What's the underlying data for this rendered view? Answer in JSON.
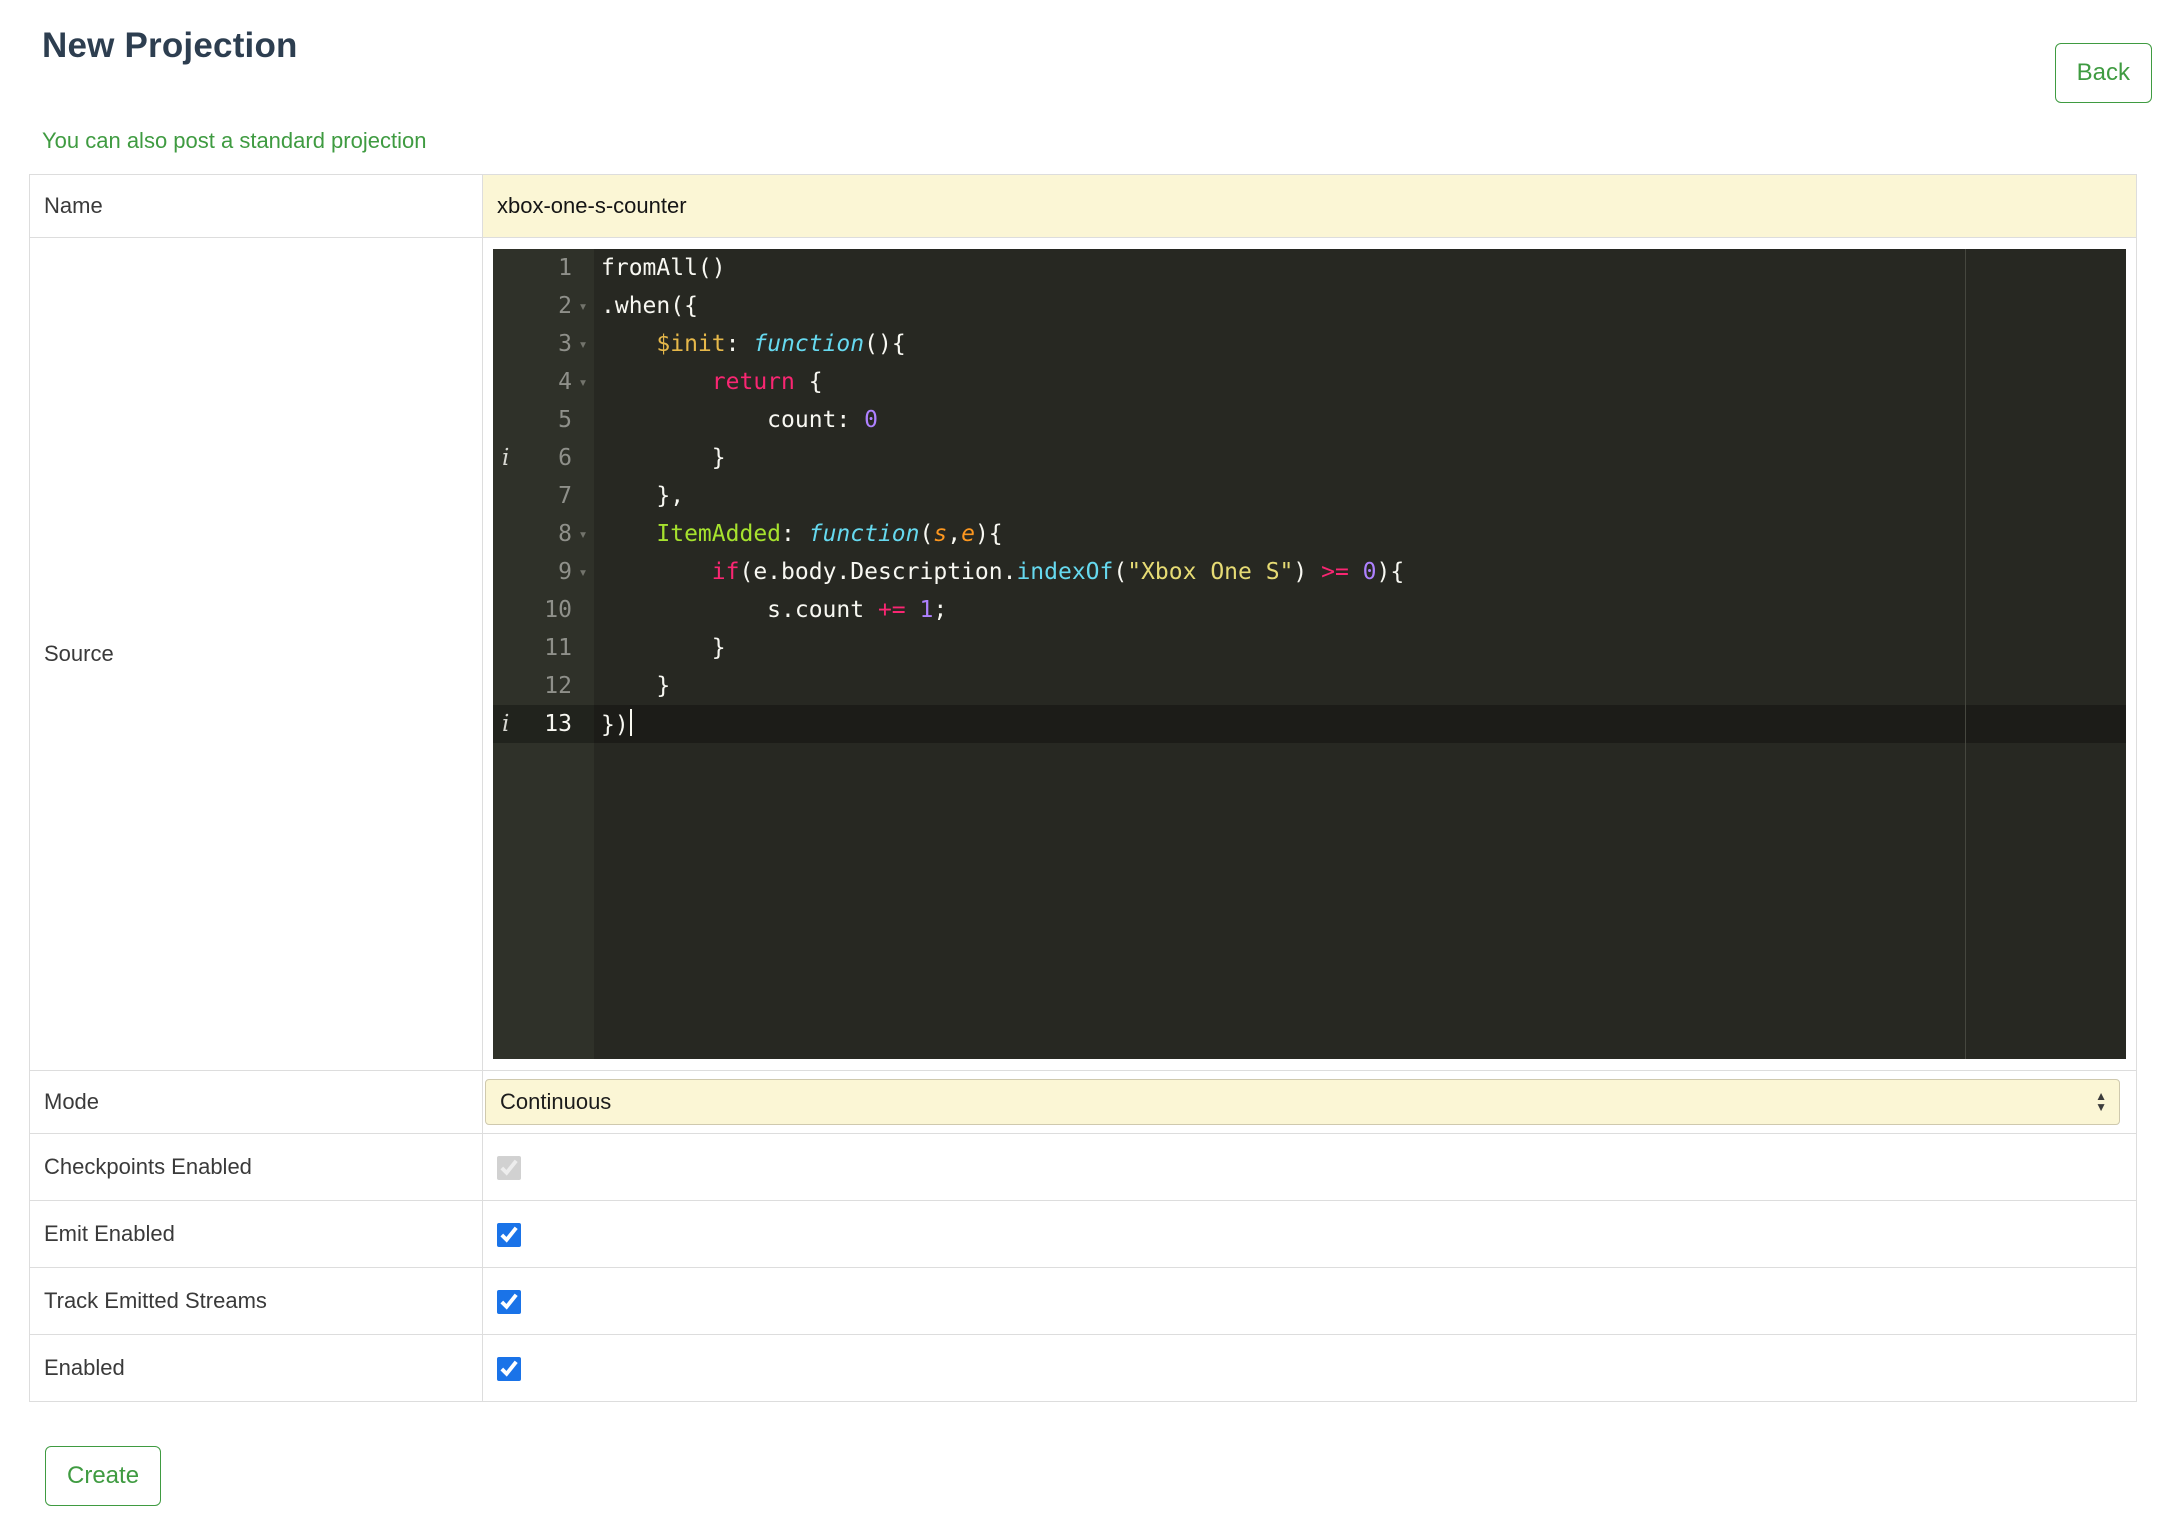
{
  "header": {
    "title": "New Projection",
    "back_button": "Back"
  },
  "hint_link": "You can also post a standard projection",
  "form": {
    "name": {
      "label": "Name",
      "value": "xbox-one-s-counter"
    },
    "source": {
      "label": "Source"
    },
    "mode": {
      "label": "Mode",
      "value": "Continuous"
    },
    "checkpoints": {
      "label": "Checkpoints Enabled",
      "checked": true,
      "disabled": true
    },
    "emit": {
      "label": "Emit Enabled",
      "checked": true,
      "disabled": false
    },
    "track": {
      "label": "Track Emitted Streams",
      "checked": true,
      "disabled": false
    },
    "enabled": {
      "label": "Enabled",
      "checked": true,
      "disabled": false
    },
    "create_button": "Create"
  },
  "colors": {
    "accent_green": "#3f9b41",
    "title_color": "#2d3e50",
    "input_bg": "#fbf6d5",
    "table_border": "#dddddd",
    "checkbox_blue": "#1a73e8",
    "editor_bg": "#272822",
    "gutter_bg": "#2f3129"
  },
  "editor": {
    "theme": {
      "plain": {
        "color": "#f8f8f2"
      },
      "kw": {
        "color": "#f92672"
      },
      "storage": {
        "color": "#66d9ef",
        "italic": true
      },
      "param": {
        "color": "#fd971f",
        "italic": true
      },
      "str": {
        "color": "#e6db74"
      },
      "num": {
        "color": "#ae81ff"
      },
      "prop": {
        "color": "#e6b84a"
      },
      "fname": {
        "color": "#a6e22e"
      },
      "support": {
        "color": "#66d9ef"
      }
    },
    "lines": [
      {
        "num": 1,
        "segments": [
          [
            "fromAll()",
            "plain"
          ]
        ]
      },
      {
        "num": 2,
        "fold": true,
        "segments": [
          [
            ".when({",
            "plain"
          ]
        ]
      },
      {
        "num": 3,
        "fold": true,
        "segments": [
          [
            "    ",
            "plain"
          ],
          [
            "$init",
            "prop"
          ],
          [
            ": ",
            "plain"
          ],
          [
            "function",
            "storage"
          ],
          [
            "(){",
            "plain"
          ]
        ]
      },
      {
        "num": 4,
        "fold": true,
        "segments": [
          [
            "        ",
            "plain"
          ],
          [
            "return",
            "kw"
          ],
          [
            " {",
            "plain"
          ]
        ]
      },
      {
        "num": 5,
        "segments": [
          [
            "            count: ",
            "plain"
          ],
          [
            "0",
            "num"
          ]
        ]
      },
      {
        "num": 6,
        "info": true,
        "segments": [
          [
            "        }",
            "plain"
          ]
        ]
      },
      {
        "num": 7,
        "segments": [
          [
            "    },",
            "plain"
          ]
        ]
      },
      {
        "num": 8,
        "fold": true,
        "segments": [
          [
            "    ",
            "plain"
          ],
          [
            "ItemAdded",
            "fname"
          ],
          [
            ": ",
            "plain"
          ],
          [
            "function",
            "storage"
          ],
          [
            "(",
            "plain"
          ],
          [
            "s",
            "param"
          ],
          [
            ",",
            "plain"
          ],
          [
            "e",
            "param"
          ],
          [
            "){",
            "plain"
          ]
        ]
      },
      {
        "num": 9,
        "fold": true,
        "segments": [
          [
            "        ",
            "plain"
          ],
          [
            "if",
            "kw"
          ],
          [
            "(e.body.Description.",
            "plain"
          ],
          [
            "indexOf",
            "support"
          ],
          [
            "(",
            "plain"
          ],
          [
            "\"Xbox One S\"",
            "str"
          ],
          [
            ") ",
            "plain"
          ],
          [
            ">=",
            "kw"
          ],
          [
            " ",
            "plain"
          ],
          [
            "0",
            "num"
          ],
          [
            "){",
            "plain"
          ]
        ]
      },
      {
        "num": 10,
        "segments": [
          [
            "            s.count ",
            "plain"
          ],
          [
            "+=",
            "kw"
          ],
          [
            " ",
            "plain"
          ],
          [
            "1",
            "num"
          ],
          [
            ";",
            "plain"
          ]
        ]
      },
      {
        "num": 11,
        "segments": [
          [
            "        }",
            "plain"
          ]
        ]
      },
      {
        "num": 12,
        "segments": [
          [
            "    }",
            "plain"
          ]
        ]
      },
      {
        "num": 13,
        "info": true,
        "active": true,
        "cursor": true,
        "segments": [
          [
            "})",
            "plain"
          ]
        ]
      }
    ]
  }
}
